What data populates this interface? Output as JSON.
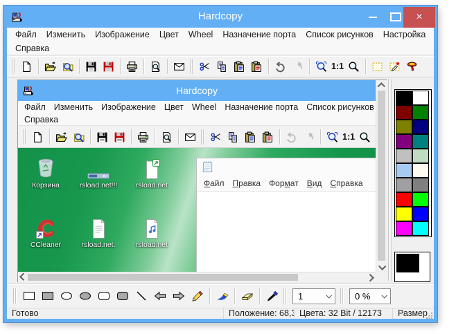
{
  "app": {
    "title": "Hardcopy",
    "close_glyph": "×"
  },
  "labels": {
    "one_to_one": "1:1"
  },
  "menubar": {
    "row1": [
      "Файл",
      "Изменить",
      "Изображение",
      "Цвет",
      "Wheel",
      "Назначение порта",
      "Список рисунков",
      "Настройка"
    ],
    "row2": [
      "Справка"
    ]
  },
  "main_toolbar": {
    "groups": [
      [
        "new-document"
      ],
      [
        "open",
        "open-preview"
      ],
      [
        "save",
        "save-as"
      ],
      [
        "print"
      ],
      [
        "print-preview"
      ],
      [
        "send-mail"
      ],
      [
        "cut",
        "copy",
        "paste",
        "paste-special"
      ],
      [
        "undo",
        "redo"
      ],
      [
        "zoom-window",
        "zoom-100",
        "zoom"
      ],
      [
        "select-rectangle",
        "edit-selection",
        "capture"
      ]
    ],
    "disabled": [
      "redo"
    ]
  },
  "child": {
    "title": "Hardcopy",
    "menubar": {
      "row1": [
        "Файл",
        "Изменить",
        "Изображение",
        "Цвет",
        "Wheel",
        "Назначение порта",
        "Список рисунков"
      ],
      "row2": [
        "Справка"
      ]
    },
    "toolbar": {
      "groups": [
        [
          "new-document"
        ],
        [
          "open",
          "open-preview"
        ],
        [
          "save",
          "save-as"
        ],
        [
          "print"
        ],
        [
          "print-preview"
        ],
        [
          "send-mail"
        ],
        [
          "cut",
          "copy",
          "paste",
          "paste-special"
        ],
        [
          "undo",
          "redo"
        ],
        [
          "zoom-window",
          "zoom-100",
          "zoom"
        ]
      ],
      "disabled": [
        "undo",
        "redo"
      ]
    }
  },
  "capture": {
    "desktop_icons": [
      {
        "label": "Корзина",
        "icon": "recycle-bin"
      },
      {
        "label": "rsload.net!!!",
        "icon": "window-strip"
      },
      {
        "label": "rsload.net",
        "icon": "shortcut-doc"
      },
      {
        "label": "CCleaner",
        "icon": "ccleaner"
      },
      {
        "label": "rsload.net.",
        "icon": "text-doc"
      },
      {
        "label": "rsload.net",
        "icon": "audio-doc"
      }
    ],
    "notepad_menu": [
      {
        "pre": "",
        "key": "Ф",
        "post": "айл"
      },
      {
        "pre": "",
        "key": "П",
        "post": "равка"
      },
      {
        "pre": "Фор",
        "key": "м",
        "post": "ат"
      },
      {
        "pre": "",
        "key": "В",
        "post": "ид"
      },
      {
        "pre": "",
        "key": "С",
        "post": "правка"
      }
    ]
  },
  "palette": {
    "colors": [
      "#000000",
      "#FFFFFF",
      "#800000",
      "#008000",
      "#808000",
      "#000080",
      "#800080",
      "#008080",
      "#C0C0C0",
      "#C0DCC0",
      "#A6CAF0",
      "#FFFBF0",
      "#A0A0A4",
      "#808080",
      "#FF0000",
      "#00FF00",
      "#FFFF00",
      "#0000FF",
      "#FF00FF",
      "#00FFFF"
    ],
    "foreground": "#000000",
    "background": "#FFFFFF"
  },
  "draw_toolbar": {
    "groups": [
      [
        "rectangle",
        "rectangle-filled",
        "ellipse",
        "ellipse-filled",
        "rounded-rectangle",
        "rounded-rectangle-filled",
        "line",
        "arrow-left",
        "arrow-right",
        "pencil"
      ],
      [
        "marker"
      ],
      [
        "eraser"
      ],
      [
        "color-picker"
      ]
    ],
    "disabled": [],
    "line_width": "1",
    "opacity": "0 %"
  },
  "status": {
    "ready": "Готово",
    "position": "Положение: 68,3",
    "colors": "Цвета: 32 Bit / 12173",
    "size": "Размер"
  }
}
